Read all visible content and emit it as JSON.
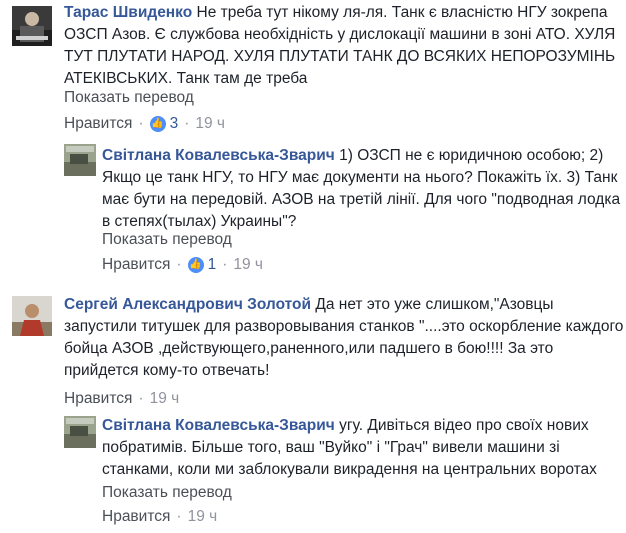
{
  "comments": [
    {
      "author": "Тарас Швиденко",
      "text": "Не треба тут нікому ля-ля. Танк є власністю НГУ зокрепа ОЗСП Азов. Є службова необхідність у дислокації машини в зоні АТО. ХУЛЯ ТУТ ПЛУТАТИ НАРОД. ХУЛЯ ПЛУТАТИ ТАНК ДО ВСЯКИХ НЕПОРОЗУМІНЬ АТЕКІВСЬКИХ. Танк там де треба",
      "see_translation": "Показать перевод",
      "like_label": "Нравится",
      "reaction_count": "3",
      "time": "19 ч"
    },
    {
      "author": "Світлана Ковалевська-Зварич",
      "text": "1) ОЗСП не є юридичною особою; 2) Якщо це танк НГУ, то НГУ має документи на нього? Покажіть їх. 3) Танк має бути на передовій. АЗОВ на третій лінії. Для чого \"подводная лодка в степях(тылах) Украины\"?",
      "see_translation": "Показать перевод",
      "like_label": "Нравится",
      "reaction_count": "1",
      "time": "19 ч"
    },
    {
      "author": "Сергей Александрович Золотой",
      "text": "Да нет это уже слишком,\"Азовцы запустили титушек для разворовывания станков \"....это оскорбление каждого бойца АЗОВ ,действующего,раненного,или падшего в бою!!!! За это прийдется кому-то отвечать!",
      "like_label": "Нравится",
      "time": "19 ч"
    },
    {
      "author": "Світлана Ковалевська-Зварич",
      "text": "угу. Дивіться відео про своїх нових побратимів. Більше того, ваш \"Вуйко\" і \"Грач\" вивели машини зі станками, коли ми заблокували викрадення на центральних воротах",
      "see_translation": "Показать перевод",
      "like_label": "Нравится",
      "time": "19 ч"
    }
  ],
  "colors": {
    "author_link": "#365899",
    "meta_gray": "#90949c",
    "like_blue": "#4d8ef8"
  }
}
